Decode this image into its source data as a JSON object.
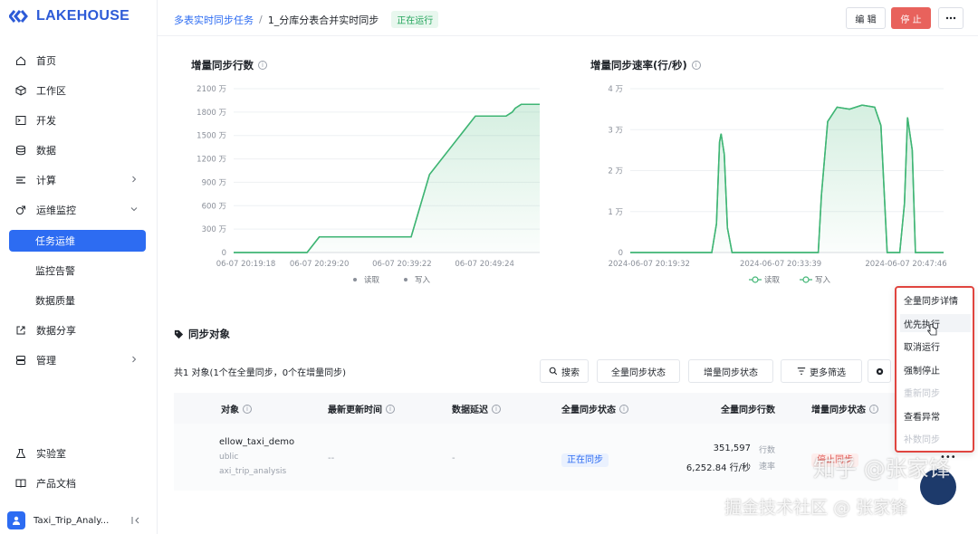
{
  "app": {
    "logo": "LAKEHOUSE"
  },
  "sidebar": {
    "items": [
      {
        "label": "首页",
        "icon": "home-icon"
      },
      {
        "label": "工作区",
        "icon": "cube-icon"
      },
      {
        "label": "开发",
        "icon": "terminal-icon"
      },
      {
        "label": "数据",
        "icon": "database-icon"
      },
      {
        "label": "计算",
        "icon": "compute-icon"
      },
      {
        "label": "运维监控",
        "icon": "monitor-icon"
      }
    ],
    "sub_items": [
      {
        "label": "任务运维",
        "active": true
      },
      {
        "label": "监控告警"
      },
      {
        "label": "数据质量"
      }
    ],
    "items2": [
      {
        "label": "数据分享",
        "icon": "share-icon"
      },
      {
        "label": "管理",
        "icon": "manage-icon"
      }
    ],
    "bottom": [
      {
        "label": "实验室",
        "icon": "flask-icon"
      },
      {
        "label": "产品文档",
        "icon": "book-icon"
      }
    ],
    "workspace": "Taxi_Trip_Analy..."
  },
  "header": {
    "crumb_parent": "多表实时同步任务",
    "crumb_sep": "/",
    "crumb_current": "1_分库分表合并实时同步",
    "status": "正在运行",
    "edit": "编 辑",
    "stop": "停 止"
  },
  "charts": {
    "left_title": "增量同步行数",
    "right_title": "增量同步速率(行/秒)",
    "legend_read": "读取",
    "legend_write": "写入"
  },
  "chart_data": [
    {
      "type": "area",
      "title": "增量同步行数",
      "y_ticks": [
        "0",
        "300 万",
        "600 万",
        "900 万",
        "1200 万",
        "1500 万",
        "1800 万",
        "2100 万"
      ],
      "ylim": [
        0,
        2100
      ],
      "x_ticks": [
        "06-07 20:19:18",
        "06-07 20:29:20",
        "06-07 20:39:22",
        "06-07 20:49:24"
      ],
      "x": [
        0,
        0.24,
        0.28,
        0.58,
        0.64,
        0.79,
        0.89,
        0.91,
        0.92,
        0.94,
        1.0
      ],
      "series": [
        {
          "name": "读取",
          "values": [
            0,
            0,
            200,
            200,
            1000,
            1750,
            1750,
            1800,
            1850,
            1900,
            1900
          ]
        },
        {
          "name": "写入",
          "values": [
            0,
            0,
            200,
            200,
            1000,
            1750,
            1750,
            1800,
            1850,
            1900,
            1900
          ]
        }
      ],
      "legend_placement": "bottom",
      "grid": true
    },
    {
      "type": "area",
      "title": "增量同步速率(行/秒)",
      "y_ticks": [
        "0",
        "1 万",
        "2 万",
        "3 万",
        "4 万"
      ],
      "ylim": [
        0,
        4
      ],
      "x_ticks": [
        "2024-06-07 20:19:32",
        "2024-06-07 20:33:39",
        "2024-06-07 20:47:46"
      ],
      "x": [
        0,
        0.26,
        0.275,
        0.285,
        0.29,
        0.3,
        0.31,
        0.325,
        0.6,
        0.61,
        0.63,
        0.66,
        0.7,
        0.74,
        0.78,
        0.8,
        0.82,
        0.86,
        0.875,
        0.885,
        0.9,
        0.91,
        0.925,
        1.0
      ],
      "series": [
        {
          "name": "读取",
          "values": [
            0,
            0,
            0.7,
            2.7,
            2.9,
            2.4,
            0.6,
            0,
            0,
            1.4,
            3.2,
            3.55,
            3.5,
            3.6,
            3.55,
            3.1,
            0,
            0,
            1.2,
            3.3,
            2.5,
            0,
            0,
            0
          ]
        },
        {
          "name": "写入",
          "values": [
            0,
            0,
            0.7,
            2.7,
            2.9,
            2.4,
            0.6,
            0,
            0,
            1.4,
            3.2,
            3.55,
            3.5,
            3.6,
            3.55,
            3.1,
            0,
            0,
            1.2,
            3.3,
            2.5,
            0,
            0,
            0
          ]
        }
      ],
      "legend_placement": "bottom",
      "grid": true
    }
  ],
  "objects": {
    "title": "同步对象",
    "summary": "共1 对象(1个在全量同步，0个在增量同步)",
    "tools": {
      "search": "搜索",
      "full_status": "全量同步状态",
      "inc_status": "增量同步状态",
      "more_filter": "更多筛选"
    },
    "columns": {
      "object": "对象",
      "updated": "最新更新时间",
      "delay": "数据延迟",
      "full_status": "全量同步状态",
      "full_rows": "全量同步行数",
      "inc_status": "增量同步状态"
    },
    "row": {
      "name": "ellow_taxi_demo",
      "schema": "ublic",
      "db": "axi_trip_analysis",
      "updated": "--",
      "delay": "-",
      "full_status": "正在同步",
      "rows": "351,597",
      "rows_unit": "行数",
      "rate": "6,252.84 行/秒",
      "rate_unit": "速率",
      "inc_status": "停止同步"
    }
  },
  "menu": {
    "items": [
      {
        "label": "全量同步详情",
        "state": "normal"
      },
      {
        "label": "优先执行",
        "state": "hover"
      },
      {
        "label": "取消运行",
        "state": "normal"
      },
      {
        "label": "强制停止",
        "state": "normal"
      },
      {
        "label": "重新同步",
        "state": "disabled"
      },
      {
        "label": "查看异常",
        "state": "normal"
      },
      {
        "label": "补数同步",
        "state": "disabled"
      }
    ]
  },
  "watermark": {
    "line1": "知乎 @张家锋",
    "line2": "掘金技术社区 @ 张家锋"
  },
  "colors": {
    "accent": "#2d6cf2",
    "line": "#3fb574",
    "stop": "#e8625c",
    "menu_border": "#e0453f"
  }
}
